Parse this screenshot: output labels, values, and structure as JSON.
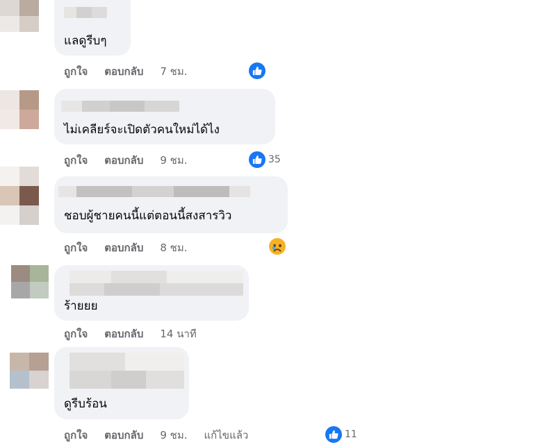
{
  "comments": [
    {
      "text": "แลดูรีบๆ",
      "actions": {
        "like": "ถูกใจ",
        "reply": "ตอบกลับ",
        "time": "7 ชม."
      },
      "reaction": {
        "icon": "like-icon",
        "count": ""
      }
    },
    {
      "text": "ไม่เคลียร์จะเปิดตัวคนใหม่ได้ไง",
      "actions": {
        "like": "ถูกใจ",
        "reply": "ตอบกลับ",
        "time": "9 ชม."
      },
      "reaction": {
        "icon": "like-icon",
        "count": "35"
      }
    },
    {
      "text": "ชอบผู้ชายคนนี้แต่ตอนนี้สงสารวิว",
      "actions": {
        "like": "ถูกใจ",
        "reply": "ตอบกลับ",
        "time": "8 ชม."
      },
      "reaction": {
        "icon": "sad-icon",
        "count": ""
      }
    },
    {
      "text": "ร้ายยย",
      "actions": {
        "like": "ถูกใจ",
        "reply": "ตอบกลับ",
        "time": "14 นาที"
      }
    },
    {
      "text": "ดูรีบร้อน",
      "actions": {
        "like": "ถูกใจ",
        "reply": "ตอบกลับ",
        "time": "9 ชม.",
        "edited": "แก้ไขแล้ว"
      },
      "reaction": {
        "icon": "like-icon",
        "count": "11"
      }
    }
  ],
  "colors": {
    "bubble": "#f0f2f5",
    "action_text": "#65676b",
    "like_blue": "#1877f2",
    "sad_yellow": "#f7b125"
  }
}
